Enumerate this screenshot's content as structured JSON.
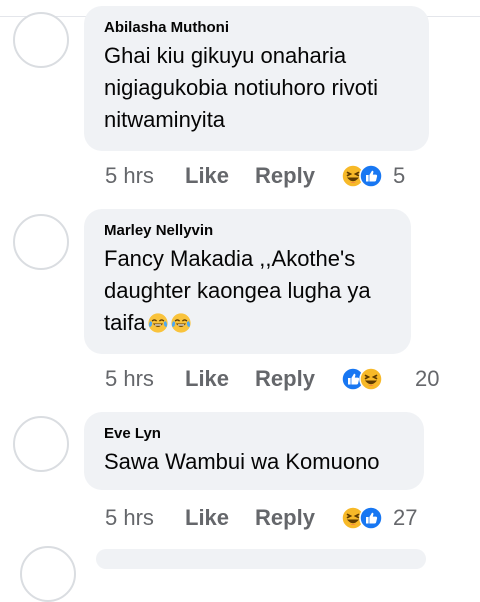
{
  "comments": [
    {
      "author": "Abilasha Muthoni",
      "text": "Ghai kiu gikuyu onaharia nigiagukobia notiuhoro rivoti nitwaminyita",
      "time": "5 hrs",
      "like_label": "Like",
      "reply_label": "Reply",
      "reaction_count": "5",
      "reactions": [
        "haha-icon",
        "like-icon"
      ]
    },
    {
      "author": "Marley Nellyvin",
      "text": "Fancy Makadia ,,Akothe's daughter kaongea lugha ya taifa",
      "inline_emojis": [
        "tears-of-joy-emoji",
        "tears-of-joy-emoji"
      ],
      "time": "5 hrs",
      "like_label": "Like",
      "reply_label": "Reply",
      "reaction_count": "20",
      "reactions": [
        "like-icon",
        "haha-icon"
      ]
    },
    {
      "author": "Eve Lyn",
      "text": "Sawa Wambui wa Komuono",
      "time": "5 hrs",
      "like_label": "Like",
      "reply_label": "Reply",
      "reaction_count": "27",
      "reactions": [
        "haha-icon",
        "like-icon"
      ]
    }
  ],
  "colors": {
    "bubble": "#f0f2f5",
    "text": "#050505",
    "meta": "#65676b",
    "like_blue": "#1877f2",
    "haha_yellow": "#f7b125"
  }
}
